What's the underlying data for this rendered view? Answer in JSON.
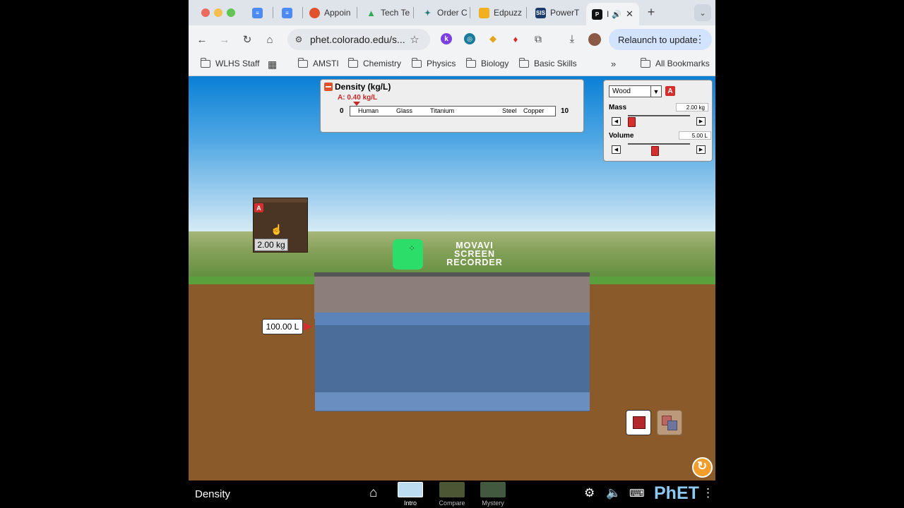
{
  "browser": {
    "tabs": [
      {
        "label": "",
        "icon": "docs-icon",
        "color": "#4c8bf5"
      },
      {
        "label": "",
        "icon": "docs-icon",
        "color": "#4c8bf5"
      },
      {
        "label": "Appoin",
        "icon": "calendar-icon",
        "color": "#e0522d"
      },
      {
        "label": "Tech Te",
        "icon": "drive-icon",
        "color": "#34a853"
      },
      {
        "label": "Order C",
        "icon": "order-icon",
        "color": "#2c7a7b"
      },
      {
        "label": "Edpuzz",
        "icon": "edpuzzle-icon",
        "color": "#f2b01e"
      },
      {
        "label": "PowerT",
        "icon": "sis-icon",
        "color": "#1c3d6b"
      },
      {
        "label": "I",
        "icon": "phet-icon",
        "color": "#111111"
      }
    ],
    "url": "phet.colorado.edu/s...",
    "relaunch_label": "Relaunch to update",
    "bookmarks": [
      "WLHS Staff",
      "AMSTI",
      "Chemistry",
      "Physics",
      "Biology",
      "Basic Skills"
    ],
    "all_bookmarks": "All Bookmarks"
  },
  "density_panel": {
    "title": "Density (kg/L)",
    "reading": "A: 0.40 kg/L",
    "min": "0",
    "max": "10",
    "materials": [
      "Human",
      "Glass",
      "Titanium",
      "Steel",
      "Copper"
    ]
  },
  "controls": {
    "material": "Wood",
    "badge": "A",
    "mass_label": "Mass",
    "mass_value": "2.00 kg",
    "volume_label": "Volume",
    "volume_value": "5.00 L"
  },
  "block": {
    "badge": "A",
    "mass": "2.00 kg"
  },
  "pool": {
    "volume": "100.00 L"
  },
  "watermark": {
    "line1": "MOVAVI",
    "line2": "SCREEN",
    "line3": "RECORDER"
  },
  "navbar": {
    "title": "Density",
    "screens": [
      "Intro",
      "Compare",
      "Mystery"
    ],
    "brand": "PhET"
  },
  "colors": {
    "accent_red": "#d32f2f",
    "water": "#456fa3",
    "ground": "#8a5a2b",
    "wood_block": "#4a3424"
  }
}
